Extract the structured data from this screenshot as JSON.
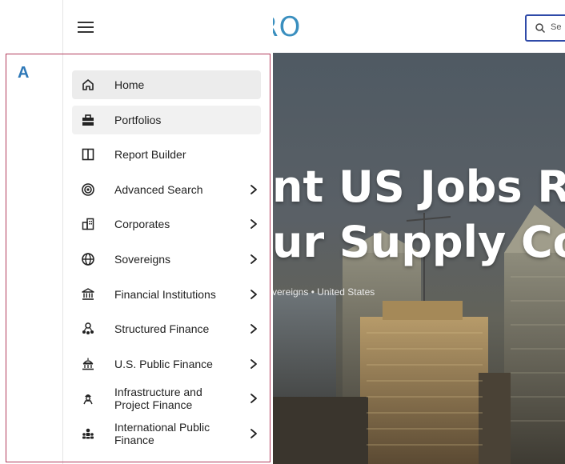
{
  "brand": {
    "text": "RO"
  },
  "search": {
    "visible_text": "Se"
  },
  "hero": {
    "line1": "nt US Jobs R",
    "line2": "ur Supply Co",
    "meta": "vereigns • United States"
  },
  "annotation": {
    "label": "A",
    "color": "#b23b5c",
    "label_color": "#2e78b7"
  },
  "nav": {
    "items": [
      {
        "id": "home",
        "icon": "home-icon",
        "label": "Home",
        "has_submenu": false,
        "state": "active"
      },
      {
        "id": "portfolios",
        "icon": "briefcase-icon",
        "label": "Portfolios",
        "has_submenu": false,
        "state": "hover"
      },
      {
        "id": "report-builder",
        "icon": "columns-icon",
        "label": "Report Builder",
        "has_submenu": false
      },
      {
        "id": "advanced-search",
        "icon": "target-icon",
        "label": "Advanced Search",
        "has_submenu": true
      },
      {
        "id": "corporates",
        "icon": "building-icon",
        "label": "Corporates",
        "has_submenu": true
      },
      {
        "id": "sovereigns",
        "icon": "globe-icon",
        "label": "Sovereigns",
        "has_submenu": true
      },
      {
        "id": "financial-institutions",
        "icon": "bank-icon",
        "label": "Financial Institutions",
        "has_submenu": true
      },
      {
        "id": "structured-finance",
        "icon": "network-icon",
        "label": "Structured Finance",
        "has_submenu": true
      },
      {
        "id": "us-public-finance",
        "icon": "capitol-icon",
        "label": "U.S. Public Finance",
        "has_submenu": true
      },
      {
        "id": "infrastructure",
        "icon": "worker-icon",
        "label": "Infrastructure and Project Finance",
        "has_submenu": true
      },
      {
        "id": "intl-public-finance",
        "icon": "people-icon",
        "label": "International Public Finance",
        "has_submenu": true
      }
    ]
  }
}
